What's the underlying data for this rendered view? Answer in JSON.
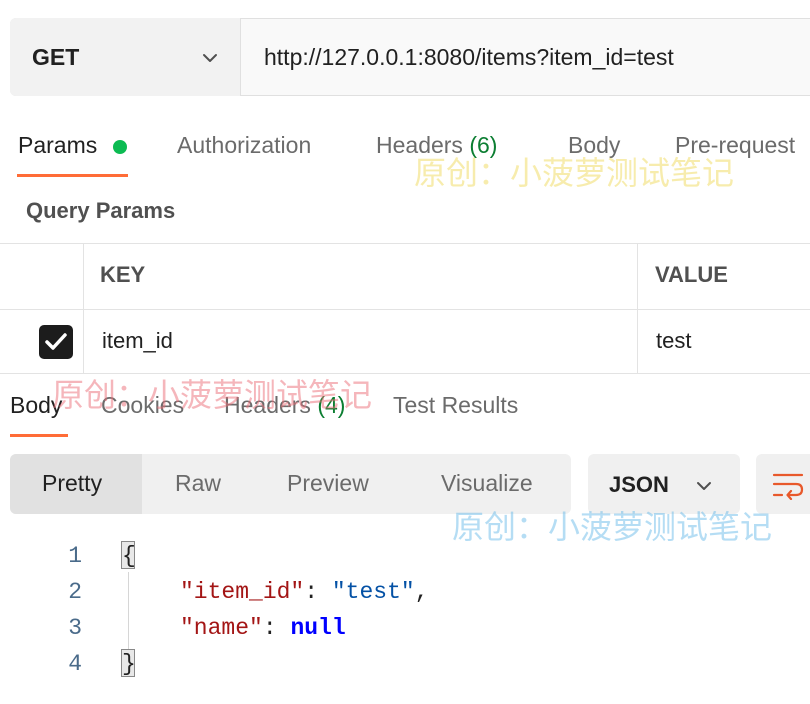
{
  "request": {
    "method": "GET",
    "url": "http://127.0.0.1:8080/items?item_id=test"
  },
  "request_tabs": [
    {
      "label": "Params",
      "count": ""
    },
    {
      "label": "Authorization",
      "count": ""
    },
    {
      "label": "Headers",
      "count": "(6)"
    },
    {
      "label": "Body",
      "count": ""
    },
    {
      "label": "Pre-request",
      "count": ""
    }
  ],
  "query_params": {
    "title": "Query Params",
    "headers": [
      "KEY",
      "VALUE"
    ],
    "rows": [
      {
        "checked": true,
        "key": "item_id",
        "value": "test"
      }
    ]
  },
  "response_tabs": [
    {
      "label": "Body",
      "count": ""
    },
    {
      "label": "Cookies",
      "count": ""
    },
    {
      "label": "Headers",
      "count": "(4)"
    },
    {
      "label": "Test Results",
      "count": ""
    }
  ],
  "format_modes": [
    "Pretty",
    "Raw",
    "Preview",
    "Visualize"
  ],
  "format_type": "JSON",
  "code_lines": {
    "numbers": [
      "1",
      "2",
      "3",
      "4"
    ],
    "open_brace": "{",
    "close_brace": "}",
    "key1": "\"item_id\"",
    "val1": "\"test\"",
    "key2": "\"name\"",
    "val2": "null",
    "colon": ":",
    "comma": ","
  },
  "watermark": "原创：小菠萝测试笔记",
  "colors": {
    "accent": "#ff6c37",
    "status_dot": "#0cbb52",
    "count": "#0c7e32"
  },
  "icons": [
    "chevron-down-icon",
    "checkmark-icon",
    "wrap-lines-icon"
  ]
}
